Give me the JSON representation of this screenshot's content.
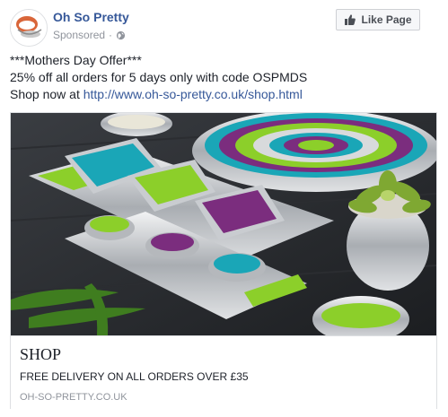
{
  "header": {
    "page_name": "Oh So Pretty",
    "sponsored_label": "Sponsored",
    "separator": "·",
    "privacy_icon": "globe-icon",
    "like_button": {
      "icon": "thumbs-up-icon",
      "label": "Like Page"
    }
  },
  "post": {
    "line1": "***Mothers Day Offer***",
    "line2": "25% off all orders for 5 days only with code OSPMDS",
    "line3_prefix": "Shop now at ",
    "line3_link": "http://www.oh-so-pretty.co.uk/shop.html"
  },
  "card": {
    "image_alt": "Silver serving bowls and trays with teal, lime and purple enamel",
    "title": "SHOP",
    "description": "FREE DELIVERY ON ALL ORDERS OVER £35",
    "domain": "OH-SO-PRETTY.CO.UK"
  },
  "colors": {
    "link": "#365899",
    "meta_text": "#90949c",
    "border": "#dddfe2",
    "teal": "#1aa6b7",
    "lime": "#8ccf2a",
    "purple": "#7b2d7e"
  }
}
